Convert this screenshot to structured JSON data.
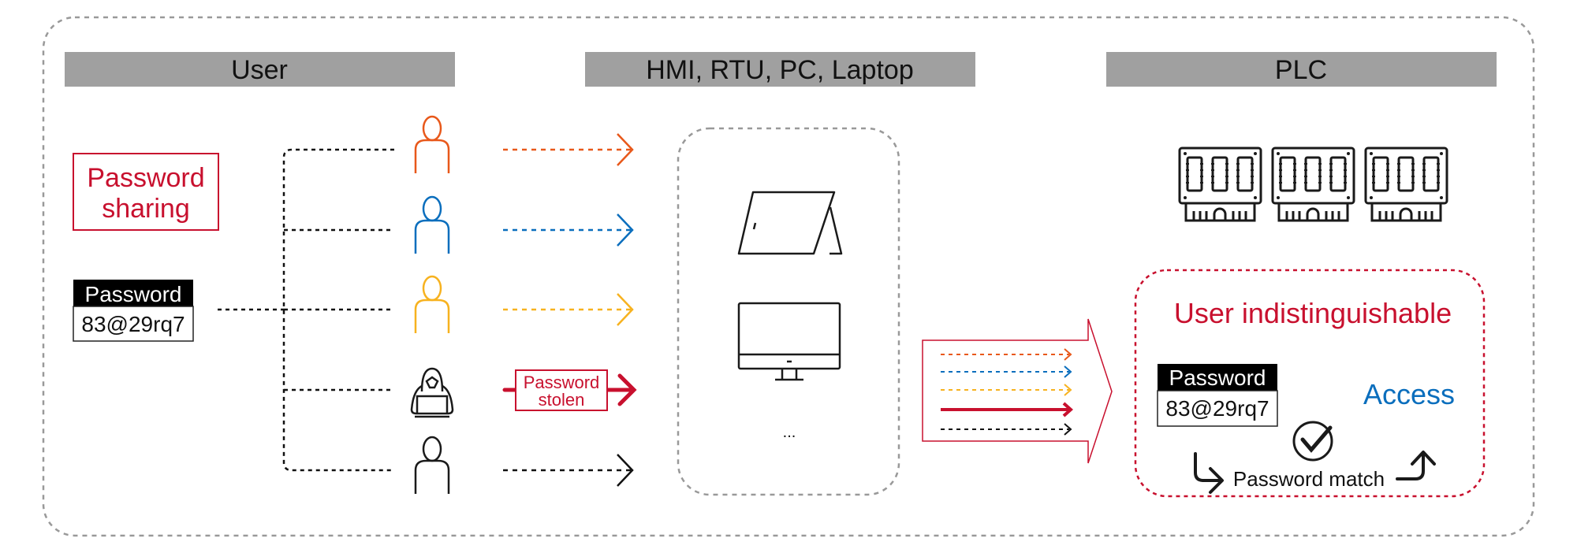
{
  "headers": {
    "user": "User",
    "devices": "HMI, RTU, PC, Laptop",
    "plc": "PLC"
  },
  "user_section": {
    "password_sharing": [
      "Password",
      "sharing"
    ],
    "password_label": "Password",
    "password_value": "83@29rq7",
    "users": [
      {
        "icon": "user-icon",
        "color": "#e8581a"
      },
      {
        "icon": "user-icon",
        "color": "#0a6ebd"
      },
      {
        "icon": "user-icon",
        "color": "#f7b21f"
      },
      {
        "icon": "hacker-icon",
        "color": "#1a1a1a"
      },
      {
        "icon": "user-icon",
        "color": "#1a1a1a"
      }
    ],
    "stolen_label": [
      "Password",
      "stolen"
    ]
  },
  "devices_section": {
    "icons": [
      "tablet-icon",
      "monitor-icon"
    ],
    "more": "..."
  },
  "plc_section": {
    "modules": [
      "plc-module-icon",
      "plc-module-icon",
      "plc-module-icon"
    ],
    "indistinguishable": "User indistinguishable",
    "password_label": "Password",
    "password_value": "83@29rq7",
    "access": "Access",
    "match": "Password match"
  },
  "colors": {
    "accent_red": "#c8102e",
    "access_blue": "#0a6ebd",
    "header_gray": "#a0a0a0",
    "dash_gray": "#999999"
  }
}
